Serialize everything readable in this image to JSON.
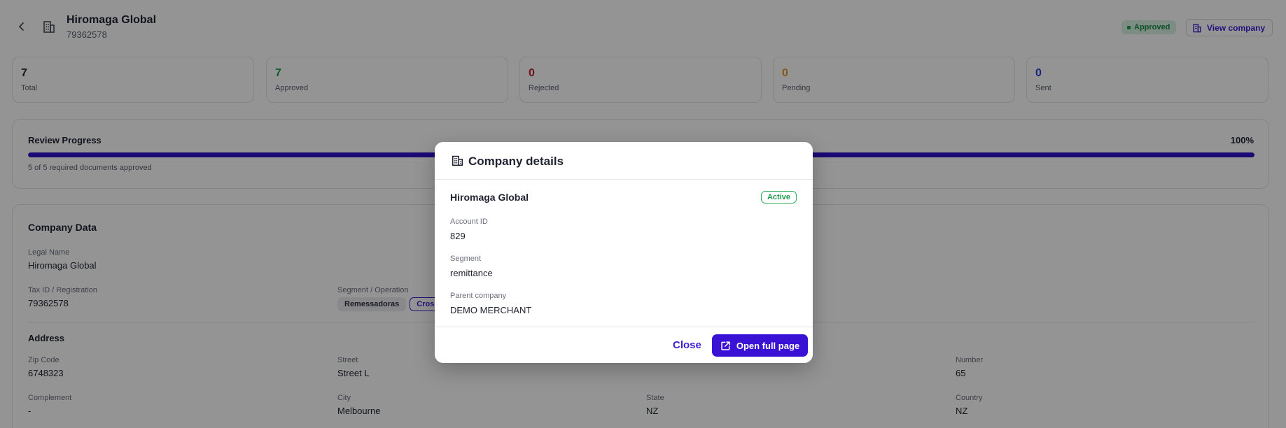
{
  "header": {
    "title": "Hiromaga Global",
    "subtitle": "79362578",
    "status_badge": "Approved",
    "view_company_label": "View company"
  },
  "stats": [
    {
      "value": "7",
      "label": "Total",
      "color": "#1f2230"
    },
    {
      "value": "7",
      "label": "Approved",
      "color": "#1a9a4c"
    },
    {
      "value": "0",
      "label": "Rejected",
      "color": "#c0183c"
    },
    {
      "value": "0",
      "label": "Pending",
      "color": "#e89a2c"
    },
    {
      "value": "0",
      "label": "Sent",
      "color": "#2b3fd6"
    }
  ],
  "review": {
    "title": "Review Progress",
    "percent_label": "100%",
    "progress": 1.0,
    "note": "5 of 5 required documents approved"
  },
  "company_data": {
    "title": "Company Data",
    "legal_name_label": "Legal Name",
    "legal_name": "Hiromaga Global",
    "tax_id_label": "Tax ID / Registration",
    "tax_id": "79362578",
    "segment_label": "Segment / Operation",
    "segments": [
      "Remessadoras",
      "Cross-"
    ],
    "address_title": "Address",
    "address": {
      "zip_label": "Zip Code",
      "zip": "6748323",
      "street_label": "Street",
      "street": "Street L",
      "number_label": "Number",
      "number": "65",
      "complement_label": "Complement",
      "complement": "-",
      "city_label": "City",
      "city": "Melbourne",
      "state_label": "State",
      "state": "NZ",
      "country_label": "Country",
      "country": "NZ"
    }
  },
  "modal": {
    "title": "Company details",
    "company_name": "Hiromaga Global",
    "status": "Active",
    "account_id_label": "Account ID",
    "account_id": "829",
    "segment_label": "Segment",
    "segment": "remittance",
    "parent_label": "Parent company",
    "parent": "DEMO MERCHANT",
    "close_label": "Close",
    "open_full_label": "Open full page"
  },
  "colors": {
    "accent": "#3a12d6",
    "progress_fill": "#2b12c8",
    "approved_green": "#158a46"
  },
  "icons": [
    "chevron-left-icon",
    "building-icon",
    "external-link-icon"
  ]
}
